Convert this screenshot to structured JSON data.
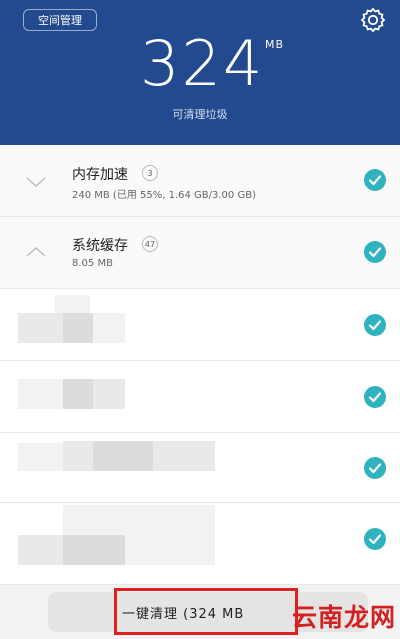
{
  "header": {
    "space_button": "空间管理",
    "icon": "gear-icon",
    "junk_amount": "324",
    "unit": "MB",
    "subtitle": "可清理垃圾",
    "background": "#23498f"
  },
  "items": [
    {
      "title": "内存加速",
      "badge": "3",
      "detail": "240 MB (已用 55%, 1.64 GB/3.00 GB)",
      "expanded": false,
      "checked": true
    },
    {
      "title": "系统缓存",
      "badge": "47",
      "detail": "8.05 MB",
      "expanded": true,
      "checked": true
    }
  ],
  "blurred_rows_checked": [
    true,
    true,
    true,
    true
  ],
  "footer": {
    "clean_button": "一键清理 (324 MB",
    "watermark": "云南龙网"
  },
  "colors": {
    "accent": "#23498f",
    "check": "#2fb3bf",
    "highlight": "#e02020"
  }
}
